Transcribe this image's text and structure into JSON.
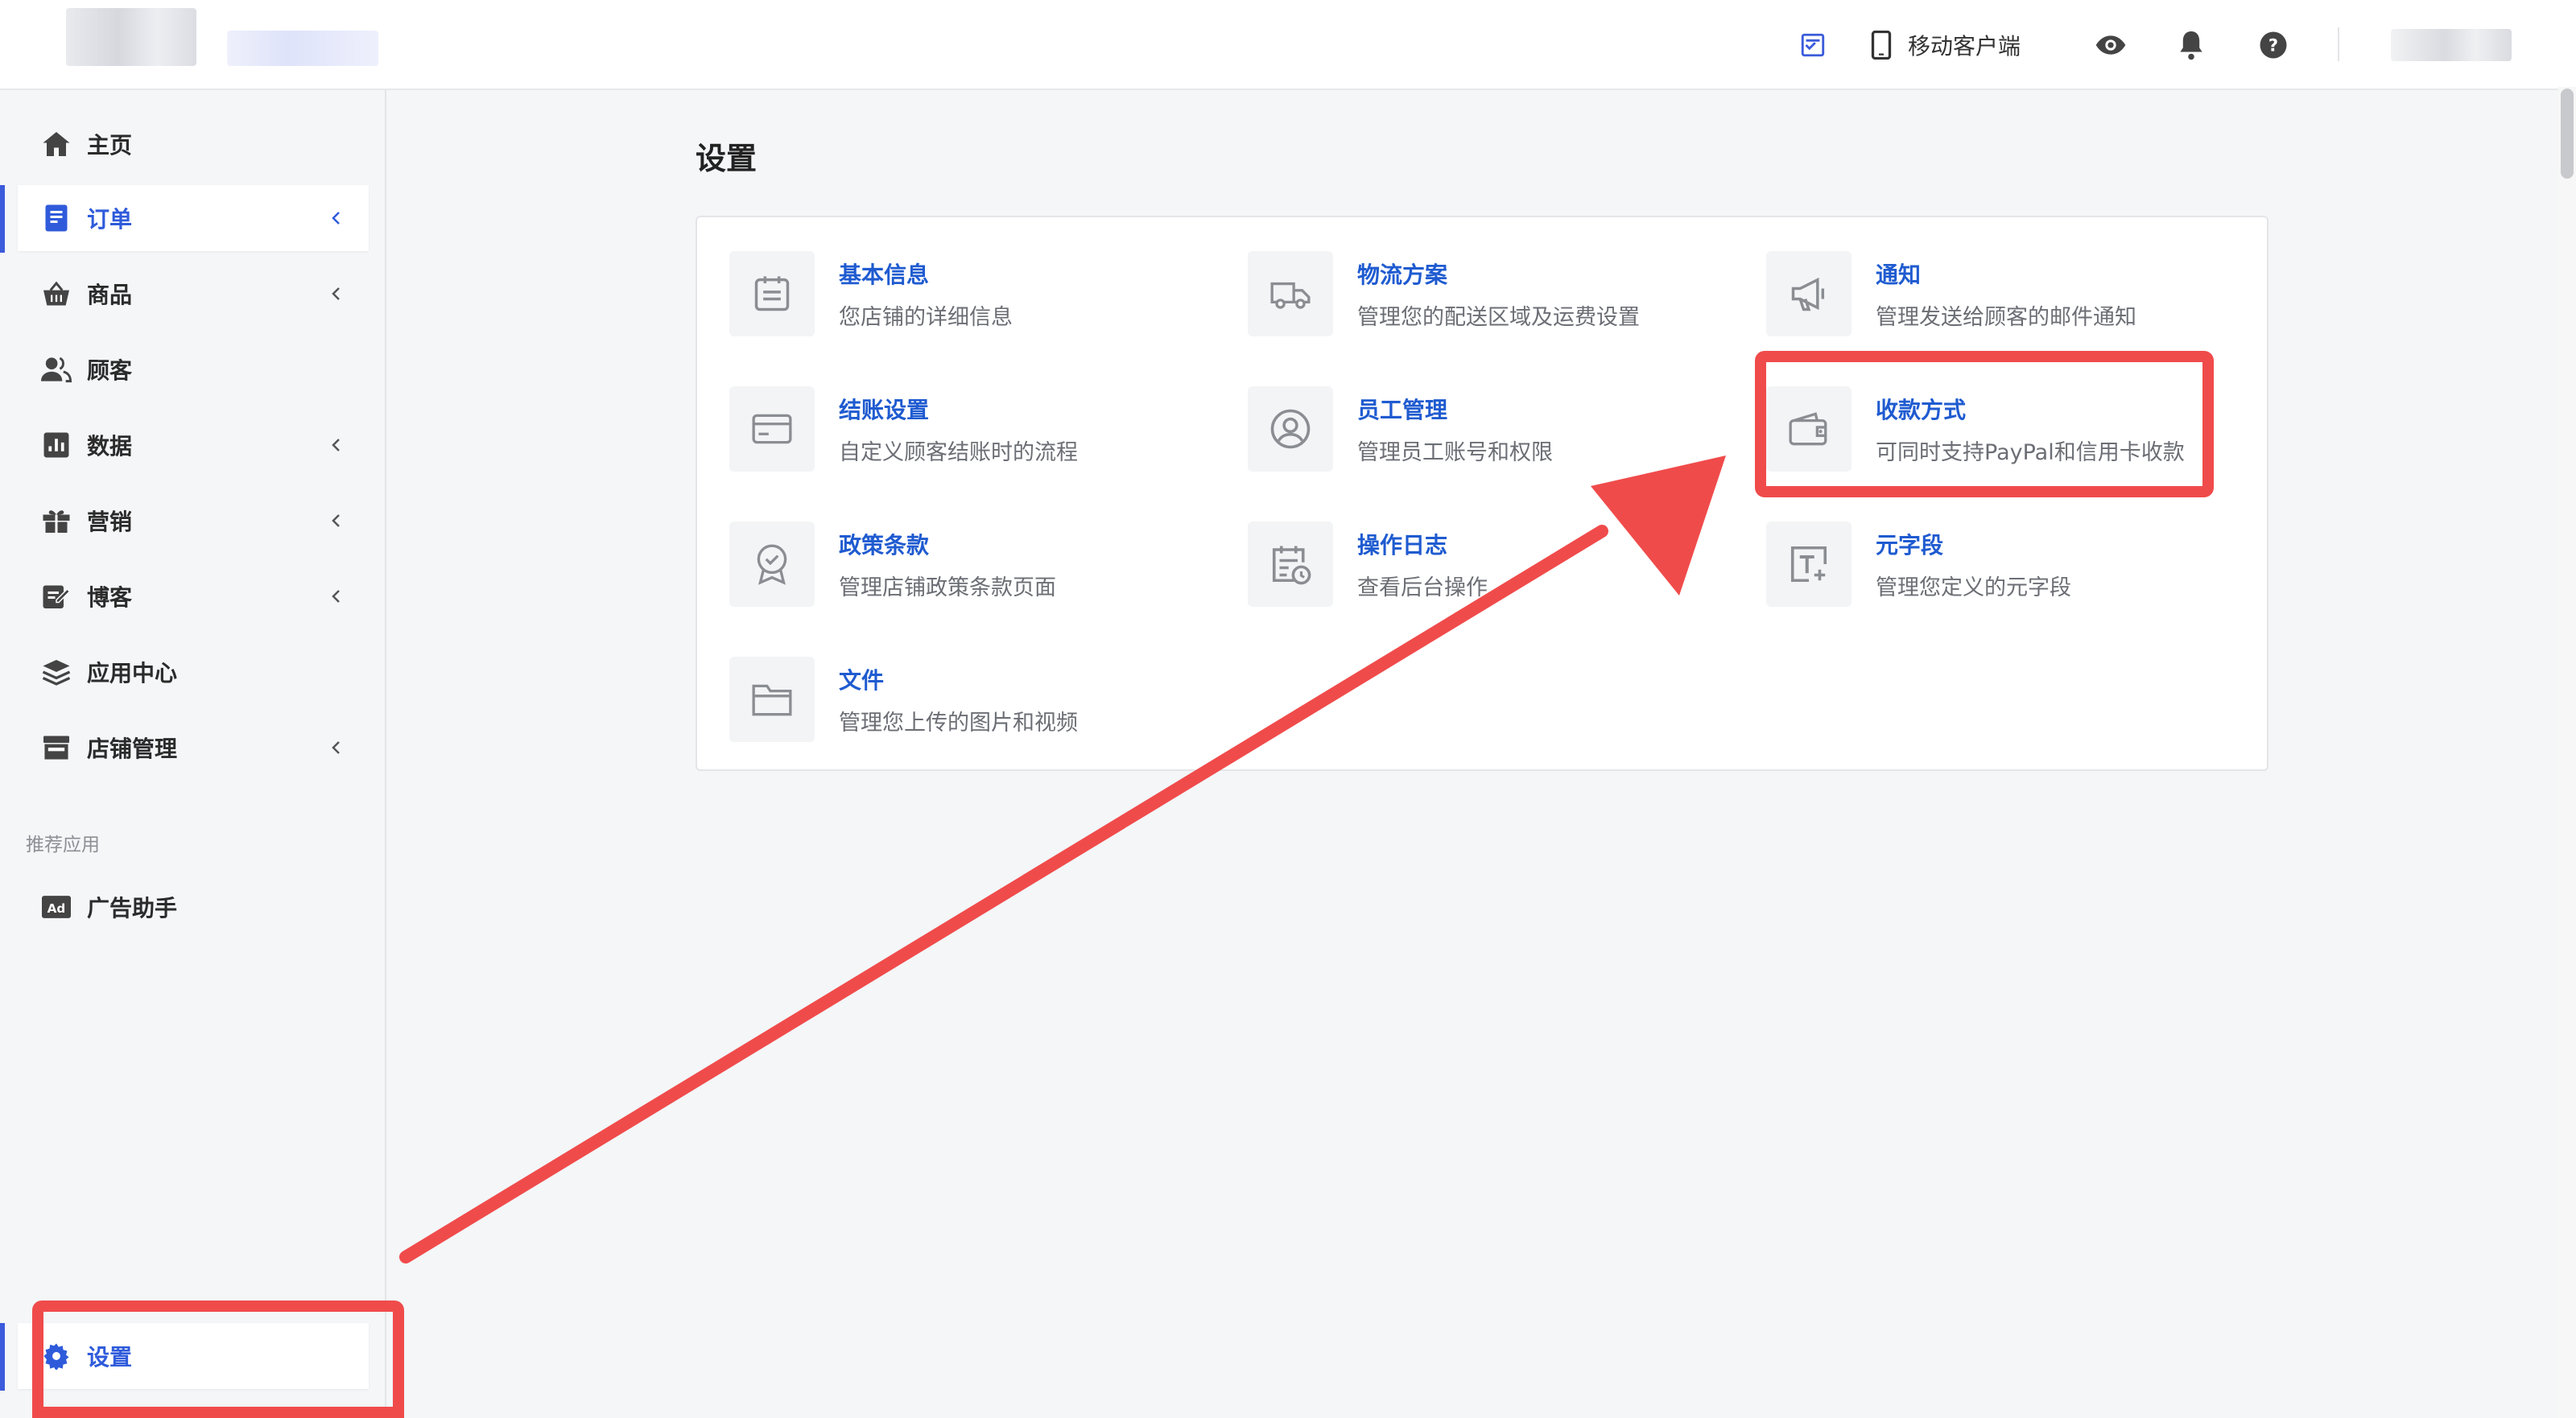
{
  "topbar": {
    "mobile_client_label": "移动客户端",
    "icons": [
      "checklist-icon",
      "mobile-phone-icon",
      "eye-icon",
      "bell-icon",
      "help-icon"
    ]
  },
  "sidebar": {
    "items": [
      {
        "label": "主页",
        "icon": "home-icon",
        "has_chevron": false
      },
      {
        "label": "订单",
        "icon": "orders-icon",
        "has_chevron": true,
        "active": true
      },
      {
        "label": "商品",
        "icon": "basket-icon",
        "has_chevron": true
      },
      {
        "label": "顾客",
        "icon": "customers-icon",
        "has_chevron": false
      },
      {
        "label": "数据",
        "icon": "chart-icon",
        "has_chevron": true
      },
      {
        "label": "营销",
        "icon": "gift-icon",
        "has_chevron": true
      },
      {
        "label": "博客",
        "icon": "edit-note-icon",
        "has_chevron": true
      },
      {
        "label": "应用中心",
        "icon": "layers-icon",
        "has_chevron": false
      },
      {
        "label": "店铺管理",
        "icon": "store-icon",
        "has_chevron": true
      }
    ],
    "recommended_section": "推荐应用",
    "recommended_items": [
      {
        "label": "广告助手",
        "icon": "ad-icon"
      }
    ],
    "settings": {
      "label": "设置",
      "icon": "gear-icon",
      "active": true
    }
  },
  "main": {
    "title": "设置",
    "tiles": [
      {
        "title": "基本信息",
        "desc": "您店铺的详细信息",
        "icon": "calendar-list-icon"
      },
      {
        "title": "物流方案",
        "desc": "管理您的配送区域及运费设置",
        "icon": "truck-icon"
      },
      {
        "title": "通知",
        "desc": "管理发送给顾客的邮件通知",
        "icon": "megaphone-icon"
      },
      {
        "title": "结账设置",
        "desc": "自定义顾客结账时的流程",
        "icon": "credit-card-icon"
      },
      {
        "title": "员工管理",
        "desc": "管理员工账号和权限",
        "icon": "user-circle-icon"
      },
      {
        "title": "收款方式",
        "desc": "可同时支持PayPal和信用卡收款",
        "icon": "wallet-icon"
      },
      {
        "title": "政策条款",
        "desc": "管理店铺政策条款页面",
        "icon": "badge-icon"
      },
      {
        "title": "操作日志",
        "desc": "查看后台操作",
        "icon": "log-calendar-icon"
      },
      {
        "title": "元字段",
        "desc": "管理您定义的元字段",
        "icon": "text-field-icon"
      },
      {
        "title": "文件",
        "desc": "管理您上传的图片和视频",
        "icon": "folder-icon"
      }
    ]
  },
  "colors": {
    "accent": "#2f5bdb",
    "link": "#1f5bd0",
    "annotation": "#f04b4b"
  }
}
